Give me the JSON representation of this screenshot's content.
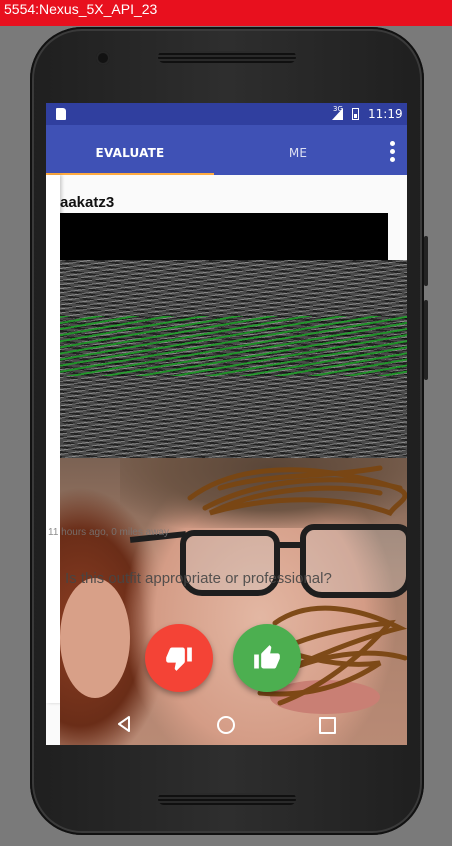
{
  "emulator": {
    "title": "5554:Nexus_5X_API_23"
  },
  "status_bar": {
    "network": "3G",
    "time": "11:19"
  },
  "tabs": [
    {
      "label": "EVALUATE",
      "selected": true
    },
    {
      "label": "ME",
      "selected": false
    }
  ],
  "post": {
    "username": "aakatz3",
    "meta": "11 hours ago, 0 miles away",
    "question": "Is this outfit appropriate or professional?"
  },
  "actions": {
    "dislike_icon": "thumb-down-icon",
    "like_icon": "thumb-up-icon"
  },
  "colors": {
    "status_bar": "#303f9f",
    "app_bar": "#3f51b5",
    "tab_indicator": "#ffab40",
    "dislike": "#f44336",
    "like": "#4caf50",
    "emulator_title": "#e8101e"
  },
  "icons": {
    "nav_back": "back-triangle-icon",
    "nav_home": "home-circle-icon",
    "nav_recents": "recents-square-icon",
    "overflow": "more-vert-icon"
  }
}
